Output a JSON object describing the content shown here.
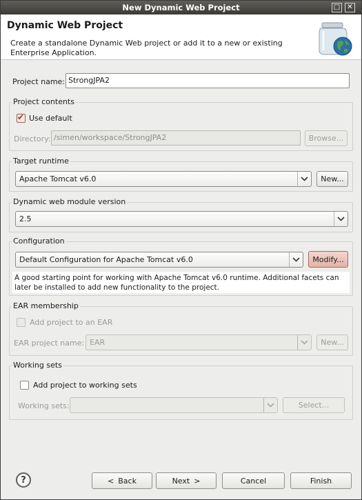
{
  "window": {
    "title": "New Dynamic Web Project"
  },
  "banner": {
    "title": "Dynamic Web Project",
    "description": "Create a standalone Dynamic Web project or add it to a new or existing Enterprise Application."
  },
  "project_name": {
    "label": "Project name:",
    "value": "StrongJPA2"
  },
  "project_contents": {
    "title": "Project contents",
    "use_default_label": "Use default",
    "use_default_checked": true,
    "directory_label": "Directory:",
    "directory_value": "/simen/workspace/StrongJPA2",
    "browse_label": "Browse..."
  },
  "target_runtime": {
    "title": "Target runtime",
    "selected": "Apache Tomcat v6.0",
    "new_label": "New..."
  },
  "module_version": {
    "title": "Dynamic web module version",
    "selected": "2.5"
  },
  "configuration": {
    "title": "Configuration",
    "selected": "Default Configuration for Apache Tomcat v6.0",
    "modify_label": "Modify...",
    "description": "A good starting point for working with Apache Tomcat v6.0 runtime. Additional facets can later be installed to add new functionality to the project."
  },
  "ear_membership": {
    "title": "EAR membership",
    "add_label": "Add project to an EAR",
    "name_label": "EAR project name:",
    "selected": "EAR",
    "new_label": "New..."
  },
  "working_sets": {
    "title": "Working sets",
    "add_label": "Add project to working sets",
    "sets_label": "Working sets:",
    "selected": "",
    "select_label": "Select..."
  },
  "footer": {
    "help_glyph": "?",
    "back_label": "Back",
    "next_label": "Next",
    "cancel_label": "Cancel",
    "finish_label": "Finish"
  },
  "icons": {
    "banner_icon": "jar-globe-icon",
    "checkmark": "✔",
    "dropdown": "▼"
  }
}
